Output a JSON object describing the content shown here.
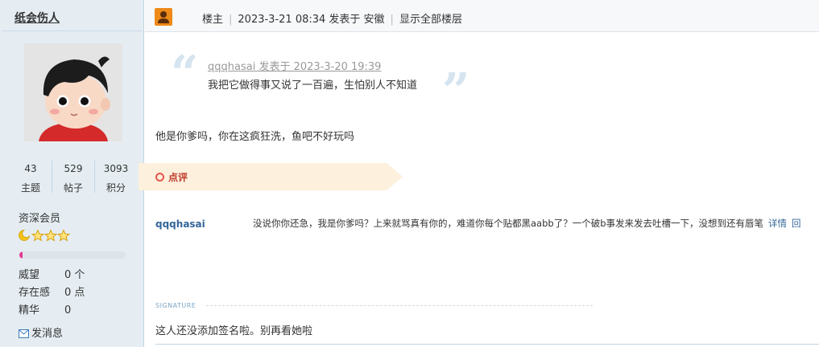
{
  "user": {
    "name": "纸会伤人",
    "stats": [
      {
        "value": "43",
        "label": "主题"
      },
      {
        "value": "529",
        "label": "帖子"
      },
      {
        "value": "3093",
        "label": "积分"
      }
    ],
    "rank": "资深会员",
    "stars": 3,
    "progress_fraction": 0.03,
    "attributes": [
      {
        "key": "威望",
        "value": "0 个"
      },
      {
        "key": "存在感",
        "value": "0 点"
      },
      {
        "key": "精华",
        "value": "0"
      }
    ],
    "send_message": "发消息"
  },
  "post_header": {
    "role": "楼主",
    "posted": "2023-3-21 08:34 发表于 安徽",
    "show_all": "显示全部楼层"
  },
  "quote": {
    "meta": "qqqhasai 发表于 2023-3-20 19:39",
    "text": "我把它做得事又说了一百遍，生怕别人不知道"
  },
  "body": "他是你爹吗，你在这疯狂洗，鱼吧不好玩吗",
  "comment": {
    "label": "点评",
    "user": "qqqhasai",
    "text": "没说你你还急，我是你爹吗？上来就骂真有你的，难道你每个贴都黑aabb了？一个破b事发来发去吐槽一下，没想到还有唇笔",
    "detail_link": "详情",
    "reply_link": "回"
  },
  "signature": {
    "label": "SIGNATURE",
    "text": "这人还没添加签名啦。别再看她啦"
  },
  "colors": {
    "sidebar_bg": "#e5edf2",
    "link_blue": "#336699",
    "owner_badge": "#ee8a18",
    "comment_accent": "#c0392b",
    "progress_fill": "#e63996"
  }
}
